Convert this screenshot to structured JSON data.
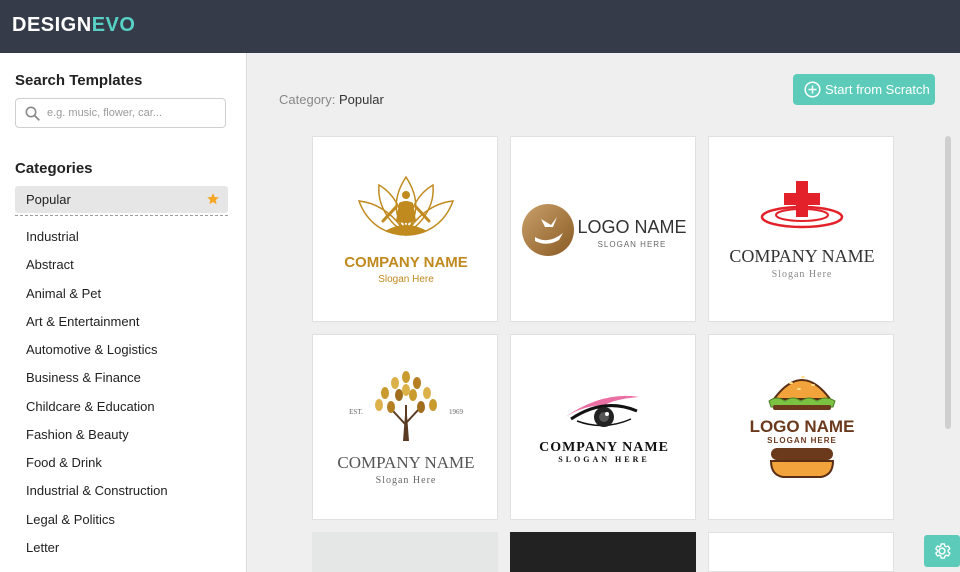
{
  "brand": {
    "part1": "DESIGN",
    "part2": "EVO"
  },
  "sidebar": {
    "search_title": "Search Templates",
    "search_placeholder": "e.g. music, flower, car...",
    "categories_title": "Categories",
    "active_category": "Popular",
    "categories": [
      "Industrial",
      "Abstract",
      "Animal & Pet",
      "Art & Entertainment",
      "Automotive & Logistics",
      "Business & Finance",
      "Childcare & Education",
      "Fashion & Beauty",
      "Food & Drink",
      "Industrial & Construction",
      "Legal & Politics",
      "Letter"
    ]
  },
  "main": {
    "category_label": "Category:",
    "category_value": "Popular",
    "start_button": "Start from Scratch",
    "templates": [
      {
        "name": "COMPANY NAME",
        "slogan": "Slogan Here"
      },
      {
        "name": "LOGO NAME",
        "slogan": "SLOGAN HERE"
      },
      {
        "name": "COMPANY NAME",
        "slogan": "Slogan Here"
      },
      {
        "name": "COMPANY NAME",
        "slogan": "Slogan Here",
        "est": "EST.",
        "year": "1969"
      },
      {
        "name": "COMPANY NAME",
        "slogan": "SLOGAN HERE"
      },
      {
        "name": "LOGO NAME",
        "slogan": "SLOGAN HERE"
      }
    ]
  },
  "colors": {
    "topbar": "#353b48",
    "accent": "#5ccbb9",
    "brand_accent": "#56d1c4",
    "gold": "#c08a1e",
    "red": "#e3212a"
  },
  "icons": {
    "search": "search-icon",
    "star": "star-icon",
    "plus_circle": "plus-circle-icon",
    "gear": "gear-icon"
  }
}
